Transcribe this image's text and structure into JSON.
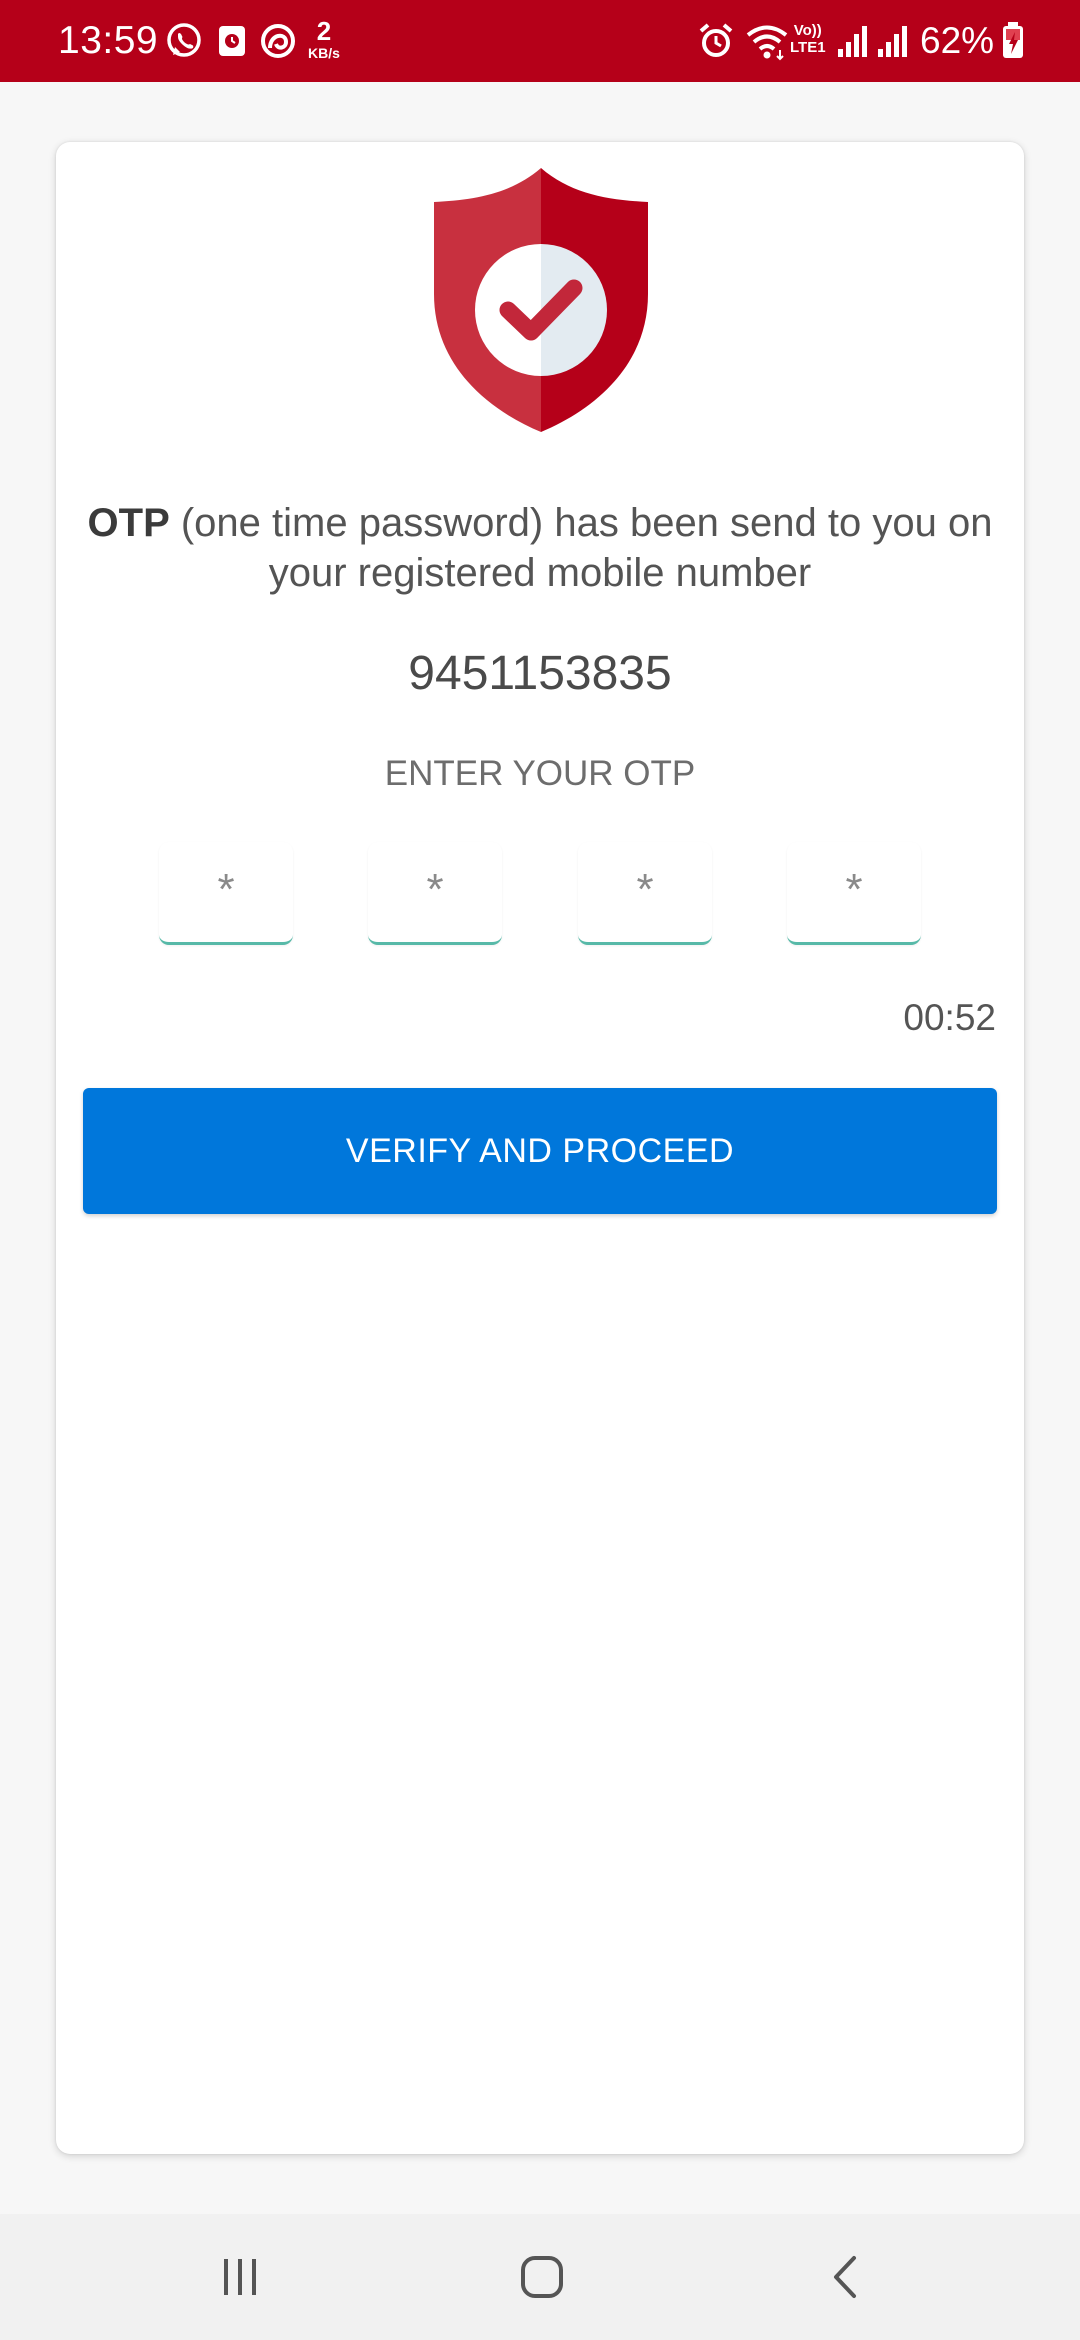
{
  "status_bar": {
    "time": "13:59",
    "network_speed_value": "2",
    "network_speed_unit": "KB/s",
    "volte_line1": "Vo))",
    "volte_line2": "LTE1",
    "battery_percent": "62%",
    "background_color": "#b50019",
    "icons": [
      "whatsapp-icon",
      "screen-recorder-icon",
      "app-notification-icon",
      "alarm-icon",
      "wifi-icon",
      "signal-icon",
      "signal-icon",
      "battery-charging-icon"
    ]
  },
  "otp_screen": {
    "message_bold": "OTP",
    "message_rest": " (one time password) has been send to you on your registered mobile number",
    "mobile_number": "9451153835",
    "enter_label": "ENTER YOUR OTP",
    "otp_digits": [
      "*",
      "*",
      "*",
      "*"
    ],
    "timer": "00:52",
    "verify_button_label": "VERIFY AND PROCEED",
    "accent_color": "#0077db",
    "shield_color": "#b50019",
    "shield_icon": "shield-check-icon"
  },
  "nav_bar": {
    "buttons": [
      "recent-apps-icon",
      "home-icon",
      "back-icon"
    ]
  }
}
